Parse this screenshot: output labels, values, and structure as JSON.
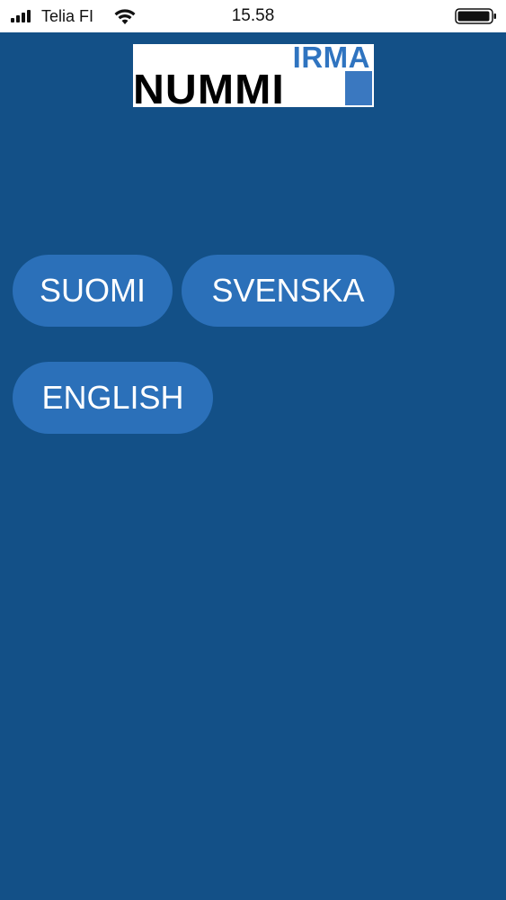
{
  "status_bar": {
    "carrier": "Telia FI",
    "time": "15.58",
    "signal_icon": "cellular-signal-icon",
    "wifi_icon": "wifi-icon",
    "battery_icon": "battery-icon",
    "battery_level": 0.9
  },
  "logo": {
    "top_text": "IRMA",
    "main_text": "NUMMI"
  },
  "languages": {
    "suomi": "SUOMI",
    "svenska": "SVENSKA",
    "english": "ENGLISH"
  },
  "colors": {
    "background": "#135087",
    "button": "#2b70b9",
    "button_text": "#ffffff",
    "logo_accent": "#2f74c0"
  }
}
